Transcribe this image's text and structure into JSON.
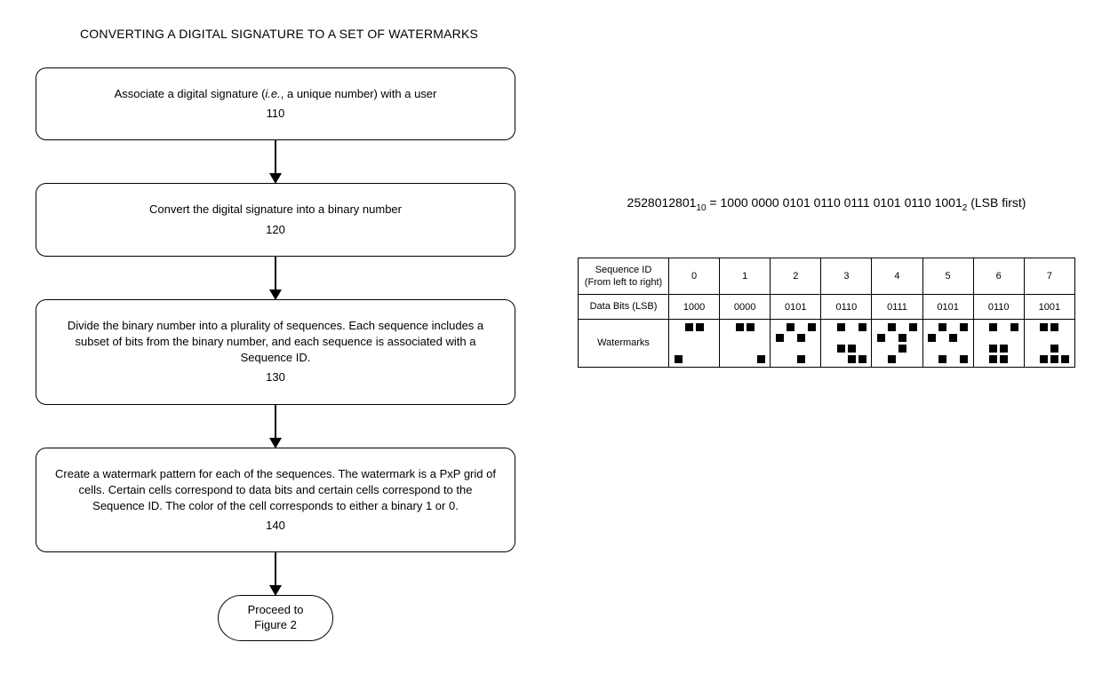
{
  "title": "CONVERTING A DIGITAL SIGNATURE TO A SET OF WATERMARKS",
  "steps": [
    {
      "text_pre": "Associate a digital signature (",
      "text_ital": "i.e.",
      "text_post": ", a unique number) with a user",
      "num": "110"
    },
    {
      "text": "Convert the digital signature into a binary number",
      "num": "120"
    },
    {
      "text": "Divide the binary number into a plurality of sequences.  Each sequence includes a subset of bits from the binary number, and each sequence is associated with a Sequence ID.",
      "num": "130"
    },
    {
      "text": "Create a watermark pattern for each of the sequences.  The watermark is a PxP grid of cells.  Certain cells correspond to data bits and certain cells correspond to the Sequence ID.  The color of the cell corresponds to either a binary 1 or 0.",
      "num": "140"
    }
  ],
  "terminator": "Proceed to\nFigure 2",
  "equation": {
    "dec": "2528012801",
    "dec_base": "10",
    "bin": "1000 0000 0101 0110 0111 0101 0110 1001",
    "bin_base": "2",
    "suffix": " (LSB first)"
  },
  "table": {
    "row1_label": "Sequence ID\n(From left to right)",
    "row2_label": "Data Bits (LSB)",
    "row3_label": "Watermarks",
    "seq_ids": [
      "0",
      "1",
      "2",
      "3",
      "4",
      "5",
      "6",
      "7"
    ],
    "data_bits": [
      "1000",
      "0000",
      "0101",
      "0110",
      "0111",
      "0101",
      "0110",
      "1001"
    ],
    "watermarks": [
      [
        0,
        1,
        1,
        0,
        0,
        0,
        0,
        0,
        0,
        0,
        0,
        0,
        1,
        0,
        0,
        0
      ],
      [
        0,
        1,
        1,
        0,
        0,
        0,
        0,
        0,
        0,
        0,
        0,
        0,
        0,
        0,
        0,
        1
      ],
      [
        0,
        1,
        0,
        1,
        1,
        0,
        1,
        0,
        0,
        0,
        0,
        0,
        0,
        0,
        1,
        0
      ],
      [
        0,
        1,
        0,
        1,
        0,
        0,
        0,
        0,
        0,
        1,
        1,
        0,
        0,
        0,
        1,
        1
      ],
      [
        0,
        1,
        0,
        1,
        1,
        0,
        1,
        0,
        0,
        0,
        1,
        0,
        0,
        1,
        0,
        0
      ],
      [
        0,
        1,
        0,
        1,
        1,
        0,
        1,
        0,
        0,
        0,
        0,
        0,
        0,
        1,
        0,
        1
      ],
      [
        0,
        1,
        0,
        1,
        0,
        0,
        0,
        0,
        0,
        1,
        1,
        0,
        0,
        1,
        1,
        0
      ],
      [
        0,
        1,
        1,
        0,
        0,
        0,
        0,
        0,
        0,
        0,
        1,
        0,
        0,
        1,
        1,
        1
      ]
    ]
  }
}
